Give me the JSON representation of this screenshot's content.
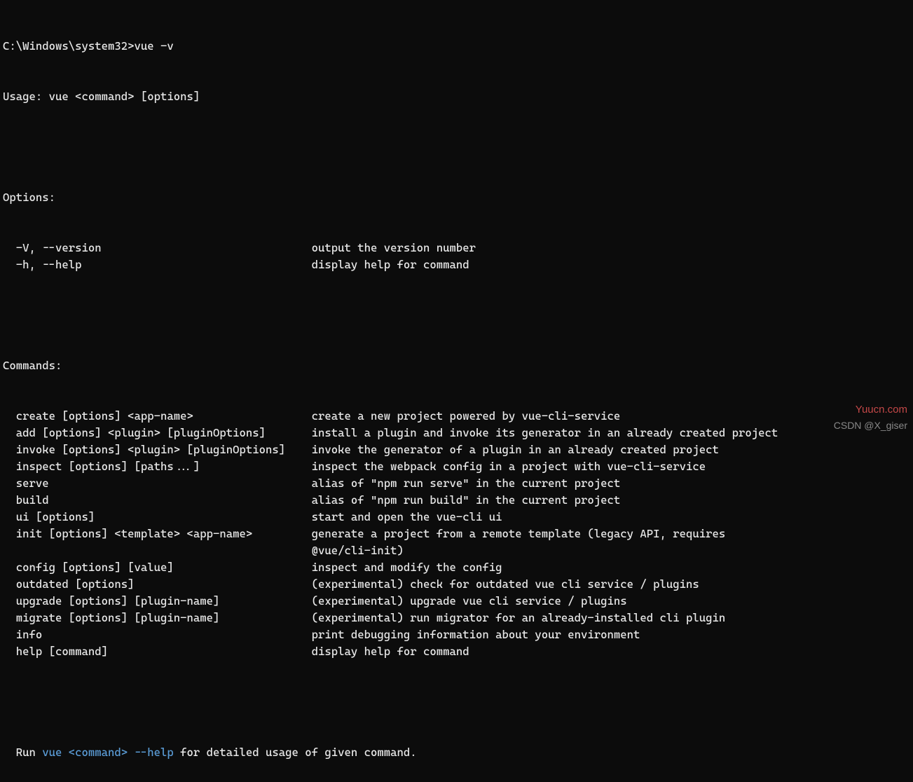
{
  "prompt": "C:\\Windows\\system32>",
  "command": "vue -v",
  "usage": "Usage: vue <command> [options]",
  "options_header": "Options:",
  "options": [
    {
      "flag": "-V, --version",
      "desc": "output the version number"
    },
    {
      "flag": "-h, --help",
      "desc": "display help for command"
    }
  ],
  "commands_header": "Commands:",
  "commands": [
    {
      "name": "create [options] <app-name>",
      "desc": "create a new project powered by vue-cli-service"
    },
    {
      "name": "add [options] <plugin> [pluginOptions]",
      "desc": "install a plugin and invoke its generator in an already created project"
    },
    {
      "name": "invoke [options] <plugin> [pluginOptions]",
      "desc": "invoke the generator of a plugin in an already created project"
    },
    {
      "name": "inspect [options] [paths...]",
      "desc": "inspect the webpack config in a project with vue-cli-service"
    },
    {
      "name": "serve",
      "desc": "alias of \"npm run serve\" in the current project"
    },
    {
      "name": "build",
      "desc": "alias of \"npm run build\" in the current project"
    },
    {
      "name": "ui [options]",
      "desc": "start and open the vue-cli ui"
    },
    {
      "name": "init [options] <template> <app-name>",
      "desc": "generate a project from a remote template (legacy API, requires"
    },
    {
      "name": "",
      "desc": "@vue/cli-init)"
    },
    {
      "name": "config [options] [value]",
      "desc": "inspect and modify the config"
    },
    {
      "name": "outdated [options]",
      "desc": "(experimental) check for outdated vue cli service / plugins"
    },
    {
      "name": "upgrade [options] [plugin-name]",
      "desc": "(experimental) upgrade vue cli service / plugins"
    },
    {
      "name": "migrate [options] [plugin-name]",
      "desc": "(experimental) run migrator for an already-installed cli plugin"
    },
    {
      "name": "info",
      "desc": "print debugging information about your environment"
    },
    {
      "name": "help [command]",
      "desc": "display help for command"
    }
  ],
  "footer_prefix": "  Run ",
  "footer_highlight": "vue <command> --help",
  "footer_suffix": " for detailed usage of given command.",
  "watermark_top": "Yuucn.com",
  "watermark_bottom": "CSDN @X_giser"
}
